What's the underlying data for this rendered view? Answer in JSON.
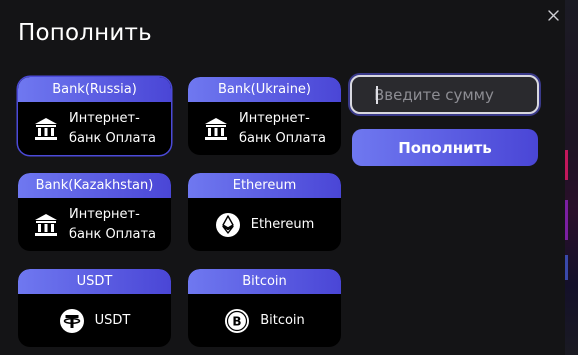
{
  "dialog": {
    "title": "Пополнить",
    "close_icon": "close-icon"
  },
  "methods": [
    {
      "header": "Bank(Russia)",
      "icon": "bank-icon",
      "line1": "Интернет-",
      "line2": "банк Оплата",
      "selected": true
    },
    {
      "header": "Bank(Ukraine)",
      "icon": "bank-icon",
      "line1": "Интернет-",
      "line2": "банк Оплата",
      "selected": false
    },
    {
      "header": "Bank(Kazakhstan)",
      "icon": "bank-icon",
      "line1": "Интернет-",
      "line2": "банк Оплата",
      "selected": false
    },
    {
      "header": "Ethereum",
      "icon": "ethereum-icon",
      "label": "Ethereum",
      "selected": false
    },
    {
      "header": "USDT",
      "icon": "tether-icon",
      "label": "USDT",
      "selected": false
    },
    {
      "header": "Bitcoin",
      "icon": "bitcoin-icon",
      "label": "Bitcoin",
      "selected": false
    }
  ],
  "amount": {
    "placeholder": "Введите сумму",
    "value": ""
  },
  "submit": {
    "label": "Пополнить"
  },
  "colors": {
    "accent_start": "#6f78f0",
    "accent_end": "#4a46d6",
    "background": "#141416",
    "card": "#000000"
  }
}
